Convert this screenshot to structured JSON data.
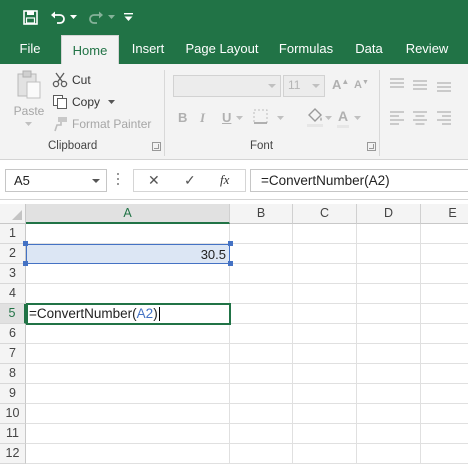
{
  "qat": {
    "icons": [
      "save-icon",
      "undo-icon",
      "undo-dropdown-icon",
      "redo-icon",
      "redo-dropdown-icon",
      "customize-qat-icon"
    ],
    "bar_color": "#217346"
  },
  "tabs": [
    "File",
    "Home",
    "Insert",
    "Page Layout",
    "Formulas",
    "Data",
    "Review"
  ],
  "active_tab": "Home",
  "ribbon": {
    "clipboard": {
      "paste_label": "Paste",
      "cut_label": "Cut",
      "copy_label": "Copy",
      "format_painter_label": "Format Painter",
      "group_label": "Clipboard"
    },
    "font": {
      "font_name": "",
      "font_size": "11",
      "bold": "B",
      "italic": "I",
      "underline": "U",
      "group_label": "Font"
    }
  },
  "formula_bar": {
    "name_box": "A5",
    "cancel_symbol": "✕",
    "enter_symbol": "✓",
    "fx_label": "fx",
    "formula": "=ConvertNumber(A2)"
  },
  "grid": {
    "columns": [
      "A",
      "B",
      "C",
      "D",
      "E"
    ],
    "rows": [
      "1",
      "2",
      "3",
      "4",
      "5",
      "6",
      "7",
      "8",
      "9",
      "10",
      "11",
      "12"
    ],
    "cells": {
      "A2": "30.5",
      "A5_prefix": "=ConvertNumber(",
      "A5_ref": "A2",
      "A5_suffix": ")"
    },
    "active_cell": "A5",
    "reference_color": "#4472c4"
  }
}
